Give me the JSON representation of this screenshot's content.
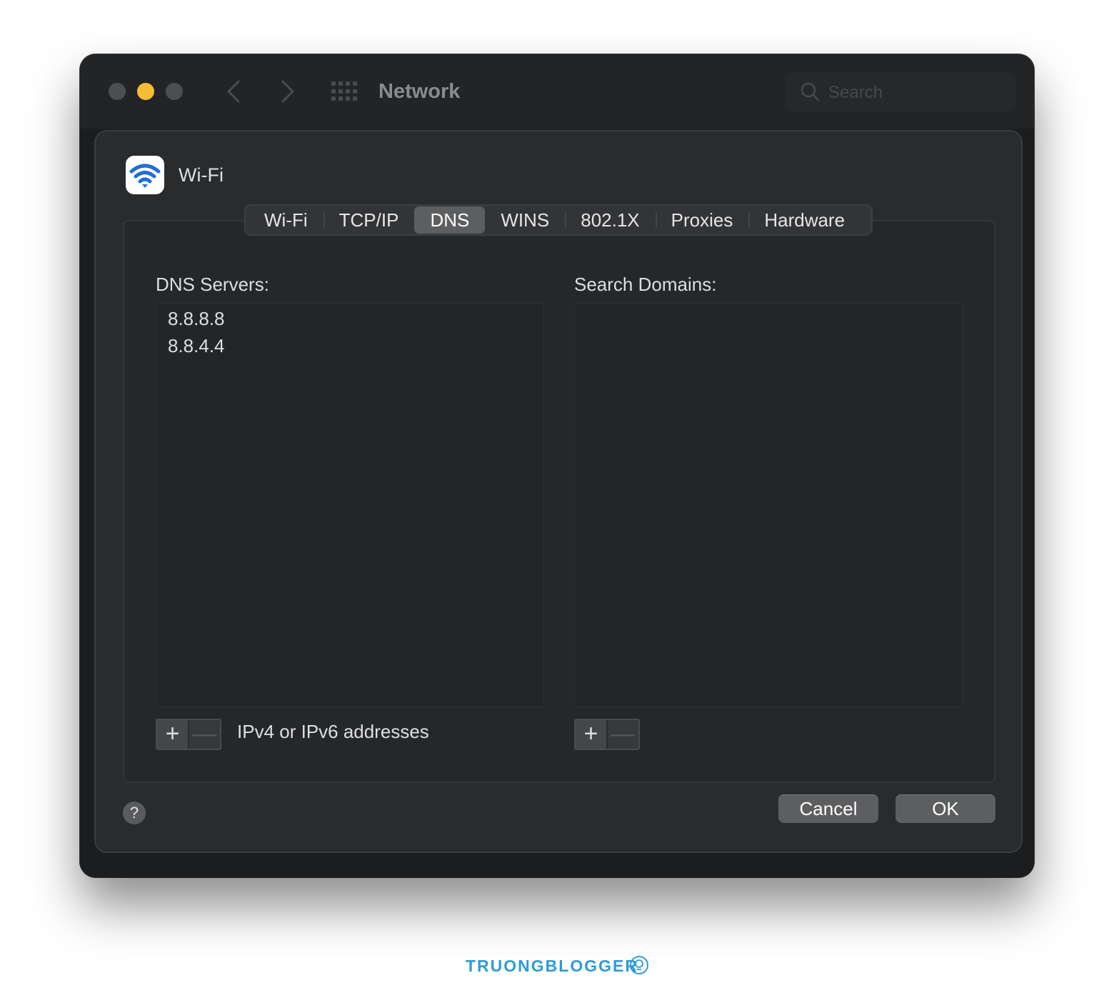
{
  "window": {
    "title": "Network",
    "search_placeholder": "Search"
  },
  "sheet": {
    "title": "Wi-Fi",
    "tabs": [
      {
        "label": "Wi-Fi"
      },
      {
        "label": "TCP/IP"
      },
      {
        "label": "DNS",
        "active": true
      },
      {
        "label": "WINS"
      },
      {
        "label": "802.1X"
      },
      {
        "label": "Proxies"
      },
      {
        "label": "Hardware"
      }
    ],
    "dns_servers": {
      "label": "DNS Servers:",
      "items": [
        "8.8.8.8",
        "8.8.4.4"
      ],
      "hint": "IPv4 or IPv6 addresses"
    },
    "search_domains": {
      "label": "Search Domains:",
      "items": []
    },
    "add_label": "+",
    "remove_label": "—",
    "help_label": "?",
    "cancel_label": "Cancel",
    "ok_label": "OK"
  },
  "watermark": "TRUONGBLOGGER",
  "colors": {
    "accent_yellow": "#f5bd33",
    "wifi_blue": "#1f6fd6",
    "watermark_blue": "#2e9bd6"
  }
}
